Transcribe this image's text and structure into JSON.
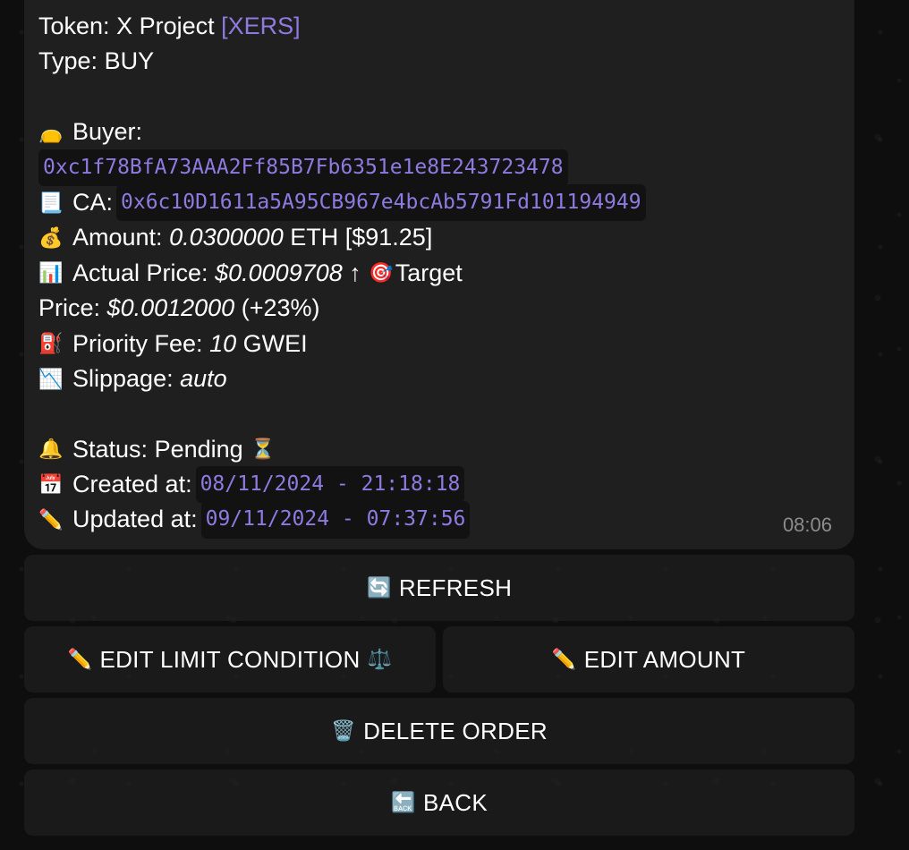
{
  "message": {
    "token_label": "Token:",
    "token_name": "X Project",
    "token_symbol": "[XERS]",
    "type_label": "Type:",
    "type_value": "BUY",
    "buyer_label": "Buyer:",
    "buyer_address": "0xc1f78BfA73AAA2Ff85B7Fb6351e1e8E243723478",
    "ca_label": "CA:",
    "ca_address": "0x6c10D1611a5A95CB967e4bcAb5791Fd101194949",
    "amount_label": "Amount:",
    "amount_value": "0.0300000",
    "amount_unit": "ETH [$91.25]",
    "actual_price_label": "Actual Price:",
    "actual_price_value": "$0.0009708",
    "arrow": "↑",
    "target_label": "Target",
    "price_label": "Price:",
    "target_price_value": "$0.0012000",
    "target_price_change": "(+23%)",
    "priority_fee_label": "Priority Fee:",
    "priority_fee_value": "10",
    "priority_fee_unit": "GWEI",
    "slippage_label": "Slippage:",
    "slippage_value": "auto",
    "status_label": "Status:",
    "status_value": "Pending",
    "created_label": "Created at:",
    "created_value": "08/11/2024 - 21:18:18",
    "updated_label": "Updated at:",
    "updated_value": "09/11/2024 - 07:37:56",
    "time": "08:06"
  },
  "icons": {
    "buyer": "money-bag-icon",
    "ca": "scroll-icon",
    "amount": "money-bag-dollar-icon",
    "actual_price": "bar-chart-icon",
    "target": "target-icon",
    "priority_fee": "fuel-pump-icon",
    "slippage": "chart-decreasing-icon",
    "status": "bell-icon",
    "pending": "hourglass-icon",
    "created": "calendar-icon",
    "updated": "pencil-icon"
  },
  "buttons": {
    "refresh": "REFRESH",
    "edit_limit": "EDIT LIMIT CONDITION",
    "edit_amount": "EDIT AMOUNT",
    "delete": "DELETE ORDER",
    "back": "BACK"
  },
  "colors": {
    "accent": "#8f7ae0",
    "bubble": "#1f1f1f",
    "background": "#0e0e0e"
  }
}
